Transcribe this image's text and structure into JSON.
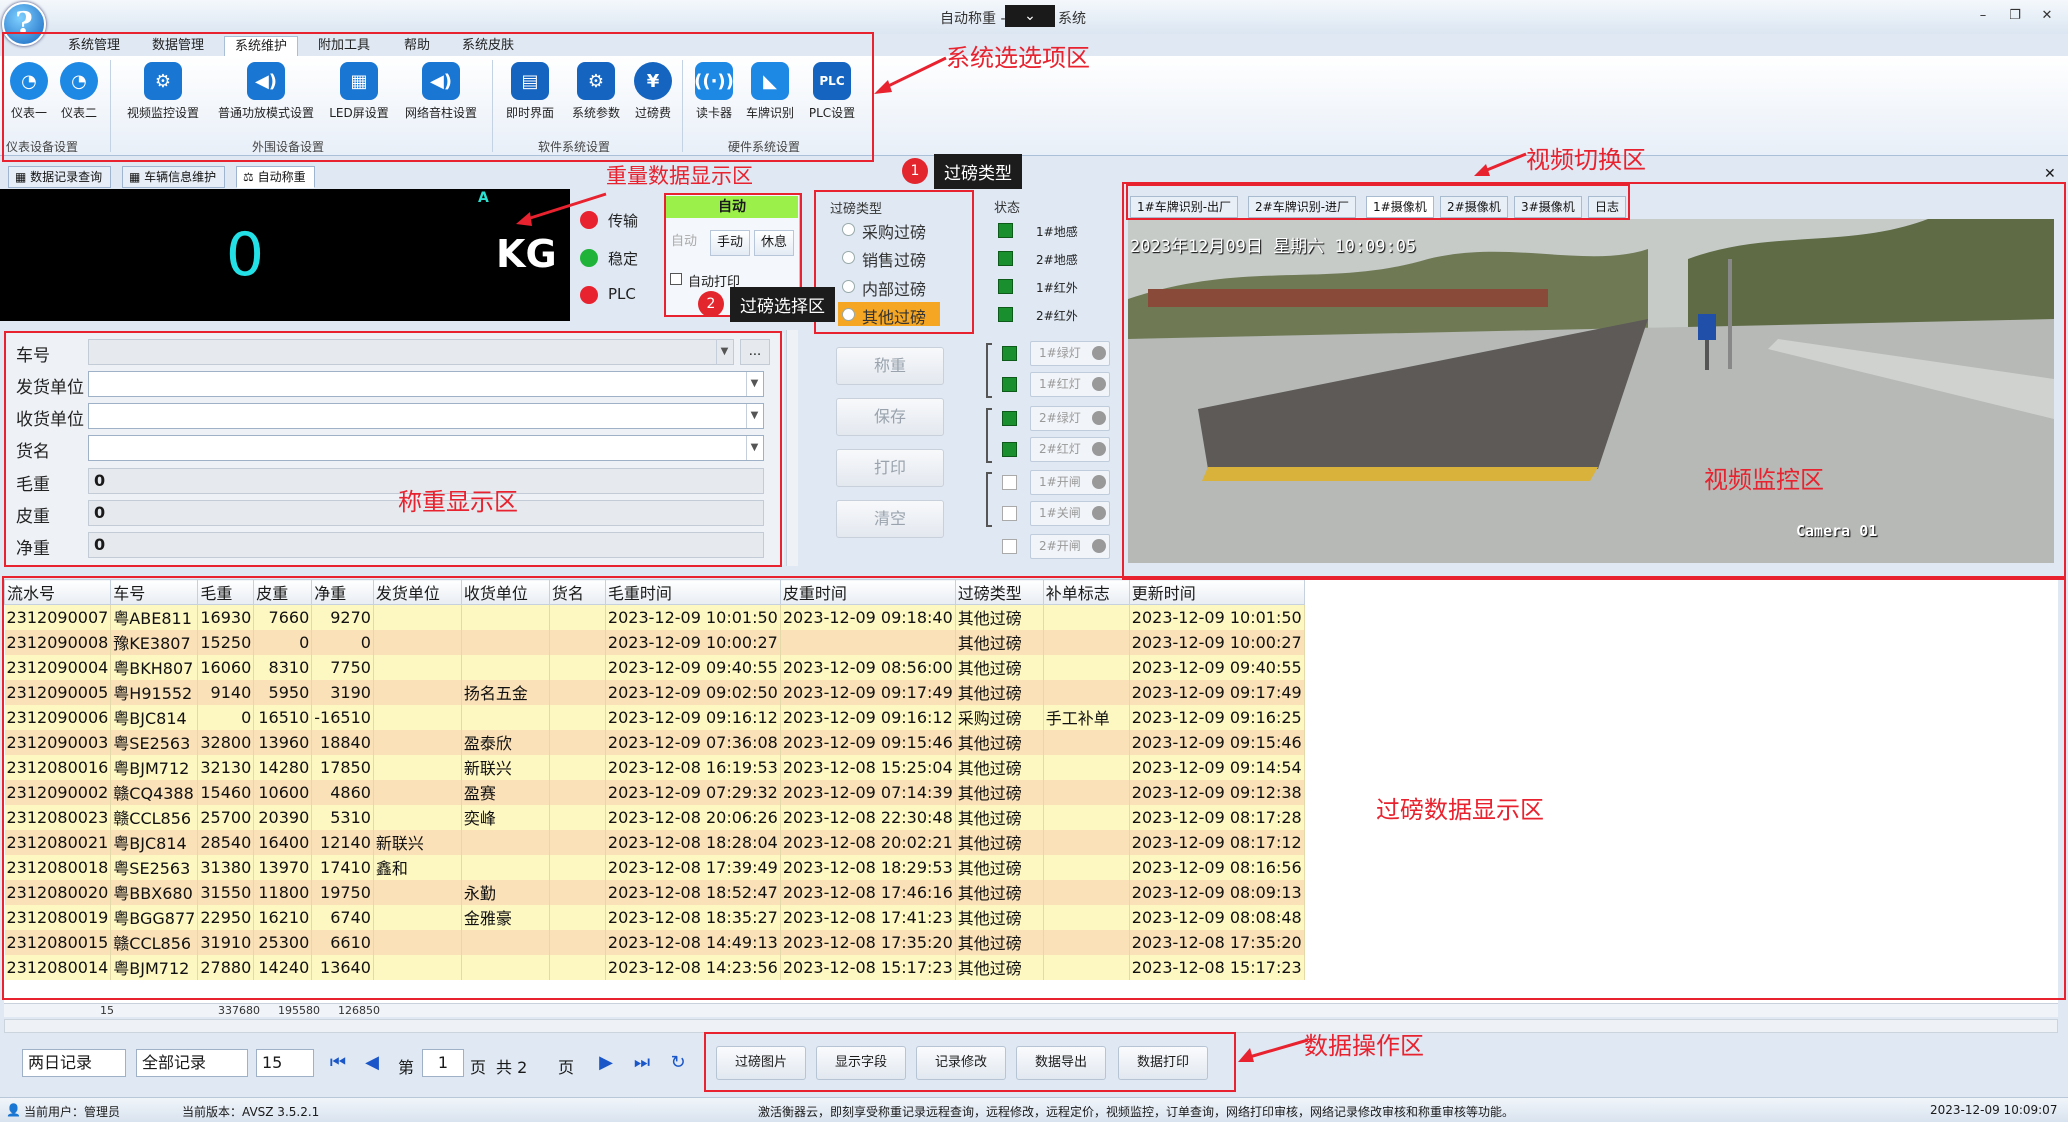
{
  "window": {
    "title_prefix": "自动称重 -",
    "title_suffix": "系统",
    "dropdown_glyph": "⌄",
    "minimize": "–",
    "restore": "❐",
    "close": "✕"
  },
  "menu": {
    "tabs": [
      "系统管理",
      "数据管理",
      "系统维护",
      "附加工具",
      "帮助",
      "系统皮肤"
    ]
  },
  "ribbon": {
    "buttons": [
      "仪表一",
      "仪表二",
      "视频监控设置",
      "普通功放模式设置",
      "LED屏设置",
      "网络音柱设置",
      "即时界面",
      "系统参数",
      "过磅费",
      "读卡器",
      "车牌识别",
      "PLC设置"
    ],
    "groups": [
      "仪表设备设置",
      "外围设备设置",
      "软件系统设置",
      "硬件系统设置"
    ]
  },
  "doc_tabs": [
    "数据记录查询",
    "车辆信息维护",
    "自动称重"
  ],
  "weight": {
    "value": "0",
    "unit": "KG",
    "flag": "A",
    "indicators": [
      {
        "label": "传输",
        "color": "#e8222e"
      },
      {
        "label": "稳定",
        "color": "#20b33a"
      },
      {
        "label": "PLC",
        "color": "#e8222e"
      }
    ]
  },
  "auto_panel": {
    "mode": "自动",
    "buttons": [
      "自动",
      "手动",
      "休息"
    ],
    "auto_print": "自动打印"
  },
  "transit_type": {
    "header": "过磅类型",
    "options": [
      "采购过磅",
      "销售过磅",
      "内部过磅",
      "其他过磅"
    ],
    "selected": "其他过磅"
  },
  "status_panel": {
    "header": "状态",
    "sensors": [
      "1#地感",
      "2#地感",
      "1#红外",
      "2#红外"
    ],
    "lights": [
      "1#绿灯",
      "1#红灯",
      "2#绿灯",
      "2#红灯",
      "1#开闸",
      "1#关闸",
      "2#开闸"
    ]
  },
  "form": {
    "fields": [
      {
        "label": "车号",
        "value": ""
      },
      {
        "label": "发货单位",
        "value": ""
      },
      {
        "label": "收货单位",
        "value": ""
      },
      {
        "label": "货名",
        "value": ""
      },
      {
        "label": "毛重",
        "value": "0"
      },
      {
        "label": "皮重",
        "value": "0"
      },
      {
        "label": "净重",
        "value": "0"
      }
    ],
    "ellipsis": "..."
  },
  "actions": [
    "称重",
    "保存",
    "打印",
    "清空"
  ],
  "video": {
    "tabs": [
      "1#车牌识别-出厂",
      "2#车牌识别-进厂",
      "1#摄像机",
      "2#摄像机",
      "3#摄像机",
      "日志"
    ],
    "active_tab": "1#摄像机",
    "timestamp": "2023年12月09日 星期六 10:09:05",
    "camera_label": "Camera 01"
  },
  "table": {
    "columns": [
      "流水号",
      "车号",
      "毛重",
      "皮重",
      "净重",
      "发货单位",
      "收货单位",
      "货名",
      "毛重时间",
      "皮重时间",
      "过磅类型",
      "补单标志",
      "更新时间"
    ],
    "rows": [
      [
        "2312090007",
        "粤ABE811",
        "16930",
        "7660",
        "9270",
        "",
        "",
        "",
        "2023-12-09 10:01:50",
        "2023-12-09 09:18:40",
        "其他过磅",
        "",
        "2023-12-09 10:01:50"
      ],
      [
        "2312090008",
        "豫KE3807",
        "15250",
        "0",
        "0",
        "",
        "",
        "",
        "2023-12-09 10:00:27",
        "",
        "其他过磅",
        "",
        "2023-12-09 10:00:27"
      ],
      [
        "2312090004",
        "粤BKH807",
        "16060",
        "8310",
        "7750",
        "",
        "",
        "",
        "2023-12-09 09:40:55",
        "2023-12-09 08:56:00",
        "其他过磅",
        "",
        "2023-12-09 09:40:55"
      ],
      [
        "2312090005",
        "粤H91552",
        "9140",
        "5950",
        "3190",
        "",
        "扬名五金",
        "",
        "2023-12-09 09:02:50",
        "2023-12-09 09:17:49",
        "其他过磅",
        "",
        "2023-12-09 09:17:49"
      ],
      [
        "2312090006",
        "粤BJC814",
        "0",
        "16510",
        "-16510",
        "",
        "",
        "",
        "2023-12-09 09:16:12",
        "2023-12-09 09:16:12",
        "采购过磅",
        "手工补单",
        "2023-12-09 09:16:25"
      ],
      [
        "2312090003",
        "粤SE2563",
        "32800",
        "13960",
        "18840",
        "",
        "盈泰欣",
        "",
        "2023-12-09 07:36:08",
        "2023-12-09 09:15:46",
        "其他过磅",
        "",
        "2023-12-09 09:15:46"
      ],
      [
        "2312080016",
        "粤BJM712",
        "32130",
        "14280",
        "17850",
        "",
        "新联兴",
        "",
        "2023-12-08 16:19:53",
        "2023-12-08 15:25:04",
        "其他过磅",
        "",
        "2023-12-09 09:14:54"
      ],
      [
        "2312090002",
        "赣CQ4388",
        "15460",
        "10600",
        "4860",
        "",
        "盈赛",
        "",
        "2023-12-09 07:29:32",
        "2023-12-09 07:14:39",
        "其他过磅",
        "",
        "2023-12-09 09:12:38"
      ],
      [
        "2312080023",
        "赣CCL856",
        "25700",
        "20390",
        "5310",
        "",
        "奕峰",
        "",
        "2023-12-08 20:06:26",
        "2023-12-08 22:30:48",
        "其他过磅",
        "",
        "2023-12-09 08:17:28"
      ],
      [
        "2312080021",
        "粤BJC814",
        "28540",
        "16400",
        "12140",
        "新联兴",
        "",
        "",
        "2023-12-08 18:28:04",
        "2023-12-08 20:02:21",
        "其他过磅",
        "",
        "2023-12-09 08:17:12"
      ],
      [
        "2312080018",
        "粤SE2563",
        "31380",
        "13970",
        "17410",
        "鑫和",
        "",
        "",
        "2023-12-08 17:39:49",
        "2023-12-08 18:29:53",
        "其他过磅",
        "",
        "2023-12-09 08:16:56"
      ],
      [
        "2312080020",
        "粤BBX680",
        "31550",
        "11800",
        "19750",
        "",
        "永勤",
        "",
        "2023-12-08 18:52:47",
        "2023-12-08 17:46:16",
        "其他过磅",
        "",
        "2023-12-09 08:09:13"
      ],
      [
        "2312080019",
        "粤BGG877",
        "22950",
        "16210",
        "6740",
        "",
        "金雅豪",
        "",
        "2023-12-08 18:35:27",
        "2023-12-08 17:41:23",
        "其他过磅",
        "",
        "2023-12-09 08:08:48"
      ],
      [
        "2312080015",
        "赣CCL856",
        "31910",
        "25300",
        "6610",
        "",
        "",
        "",
        "2023-12-08 14:49:13",
        "2023-12-08 17:35:20",
        "其他过磅",
        "",
        "2023-12-08 17:35:20"
      ],
      [
        "2312080014",
        "粤BJM712",
        "27880",
        "14240",
        "13640",
        "",
        "",
        "",
        "2023-12-08 14:23:56",
        "2023-12-08 15:17:23",
        "其他过磅",
        "",
        "2023-12-08 15:17:23"
      ]
    ],
    "summary": {
      "count": "15",
      "gross": "337680",
      "tare": "195580",
      "net": "126850"
    }
  },
  "pager": {
    "range": "两日记录",
    "filter": "全部记录",
    "page_size": "15",
    "page_prefix": "第",
    "page": "1",
    "page_suffix": "页",
    "total_prefix": "共 2",
    "total_suffix": "页"
  },
  "data_ops": [
    "过磅图片",
    "显示字段",
    "记录修改",
    "数据导出",
    "数据打印"
  ],
  "statusbar": {
    "user": "当前用户：管理员",
    "version": "当前版本：AVSZ 3.5.2.1",
    "message": "激活衡器云，即刻享受称重记录远程查询，远程修改，远程定价，视频监控，订单查询，网络打印审核，网络记录修改审核和称重审核等功能。",
    "datetime": "2023-12-09 10:09:07"
  },
  "annotations": {
    "system_options": "系统选选项区",
    "weight_data": "重量数据显示区",
    "video_switch": "视频切换区",
    "video_monitor": "视频监控区",
    "weigh_display": "称重显示区",
    "transit_data": "过磅数据显示区",
    "data_ops": "数据操作区",
    "tip1": "过磅类型",
    "tip2": "过磅选择区",
    "marker1": "1",
    "marker2": "2"
  },
  "colors": {
    "accent_red": "#e8222e",
    "weight_cyan": "#22e0e6",
    "row_odd": "#fdf7c2",
    "row_even": "#fbe1b8"
  }
}
